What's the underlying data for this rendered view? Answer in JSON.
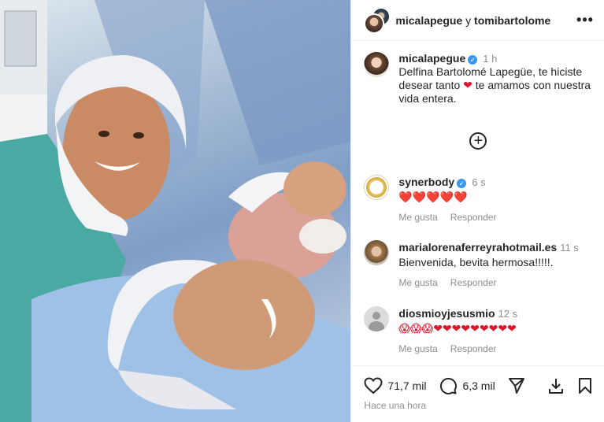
{
  "header": {
    "user1": "micalapegue",
    "conjunction": "y",
    "user2": "tomibartolome",
    "more": "•••"
  },
  "caption": {
    "username": "micalapegue",
    "time": "1 h",
    "text": "Delfina Bartolomé Lapegüe, te hiciste desear tanto",
    "emoji": "❤",
    "text2": "te amamos con nuestra vida entera."
  },
  "plus": "+",
  "comments": [
    {
      "username": "synerbody",
      "verified": true,
      "time": "6 s",
      "text": "❤️❤️❤️❤️❤️",
      "like": "Me gusta",
      "reply": "Responder"
    },
    {
      "username": "marialorenaferreyrahotmail.es",
      "verified": false,
      "time": "11 s",
      "text": "Bienvenida, bevita hermosa!!!!!.",
      "like": "Me gusta",
      "reply": "Responder"
    },
    {
      "username": "diosmioyjesusmio",
      "verified": false,
      "time": "12 s",
      "text": "😱😱😱❤❤❤❤❤❤❤❤❤",
      "like": "Me gusta",
      "reply": "Responder"
    }
  ],
  "actions": {
    "likes": "71,7 mil",
    "comments": "6,3 mil"
  },
  "posted_ago": "Hace una hora",
  "colors": {
    "verified": "#3897f0",
    "muted": "#8e8e8e",
    "heart": "#e0152b"
  }
}
